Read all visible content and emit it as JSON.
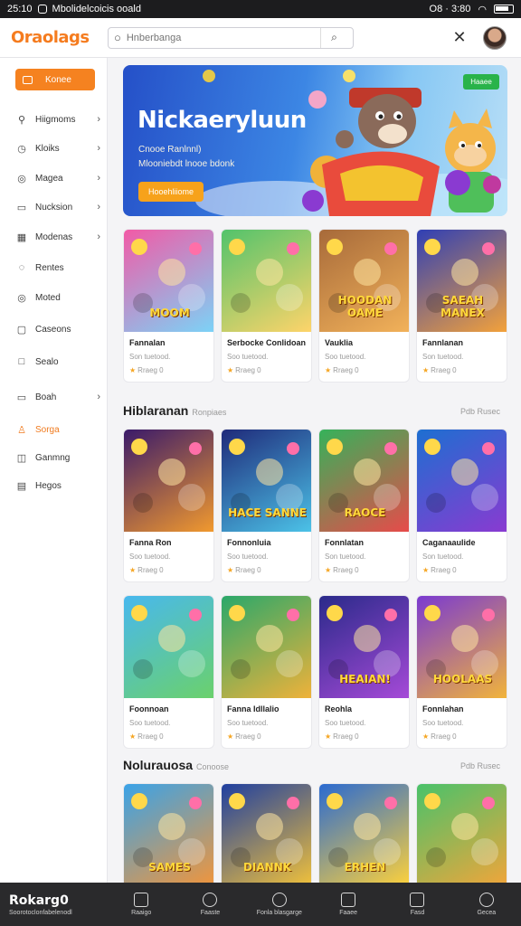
{
  "status_bar": {
    "time": "25:10",
    "notification": "Mbolidelcoicis ooald",
    "right_text": "O8 · 3:80"
  },
  "header": {
    "logo": "Oraolags",
    "search_placeholder": "Hnberbanga"
  },
  "sidebar": {
    "home_label": "Konee",
    "items": [
      {
        "label": "Hiigmoms",
        "icon": "controller-icon",
        "chevron": true
      },
      {
        "label": "Kloiks",
        "icon": "clock-icon",
        "chevron": true
      },
      {
        "label": "Magea",
        "icon": "circle-icon",
        "chevron": true
      },
      {
        "label": "Nucksion",
        "icon": "card-icon",
        "chevron": true
      },
      {
        "label": "Modenas",
        "icon": "grid-icon",
        "chevron": true
      },
      {
        "label": "Rentes",
        "icon": "shield-icon",
        "chevron": false
      },
      {
        "label": "Moted",
        "icon": "target-icon",
        "chevron": false
      },
      {
        "label": "Caseons",
        "icon": "doc-icon",
        "chevron": false
      },
      {
        "label": "Sealo",
        "icon": "box-icon",
        "chevron": false
      },
      {
        "label": "Boah",
        "icon": "folder-icon",
        "chevron": true
      },
      {
        "label": "Sorga",
        "icon": "user-icon",
        "chevron": false,
        "active": true
      },
      {
        "label": "Ganmng",
        "icon": "bag-icon",
        "chevron": false
      },
      {
        "label": "Hegos",
        "icon": "list-icon",
        "chevron": false
      }
    ]
  },
  "hero": {
    "title": "Nickaeryluun",
    "subtitle1": "Cnooe Ranlnnl)",
    "subtitle2": "Mlooniebdt lnooe bdonk",
    "button": "Hooehliiome",
    "badge": "Haaee"
  },
  "sections": [
    {
      "title": "",
      "tag": "",
      "more": "",
      "cards": [
        {
          "title": "Fannalan",
          "desc": "Son tuetood.",
          "rating": "Rraeg 0",
          "art": "MOOM",
          "c1": "#f25aa6",
          "c2": "#7bd3f7"
        },
        {
          "title": "Serbocke Conlidoan",
          "desc": "Soo tuetood.",
          "rating": "Rraeg 0",
          "art": "",
          "c1": "#52c36b",
          "c2": "#ffd46a"
        },
        {
          "title": "Vauklia",
          "desc": "Soo tuetood.",
          "rating": "Rraeg 0",
          "art": "HOODAN OAME",
          "c1": "#a76a3a",
          "c2": "#f2b25a"
        },
        {
          "title": "Fannlanan",
          "desc": "Son tuetood.",
          "rating": "Rraeg 0",
          "art": "SAEAH MANEX",
          "c1": "#2f3fb5",
          "c2": "#f4a23a"
        }
      ]
    },
    {
      "title": "Hiblaranan",
      "tag": "Ronpiaes",
      "more": "Pdb Rusec",
      "cards": [
        {
          "title": "Fanna Ron",
          "desc": "Soo tuetood.",
          "rating": "Rraeg 0",
          "art": "",
          "c1": "#3a1a6a",
          "c2": "#f29a2e"
        },
        {
          "title": "Fonnonluia",
          "desc": "Soo tuetood.",
          "rating": "Rraeg 0",
          "art": "HACE SANNE",
          "c1": "#1f2a7a",
          "c2": "#4cc3e8"
        },
        {
          "title": "Fonnlatan",
          "desc": "Son tuetood.",
          "rating": "Rraeg 0",
          "art": "RAOCE",
          "c1": "#35b25a",
          "c2": "#e84a4a"
        },
        {
          "title": "Caganaaulide",
          "desc": "Son tuetood.",
          "rating": "Rraeg 0",
          "art": "",
          "c1": "#1d6fd1",
          "c2": "#8a3ad1"
        }
      ]
    },
    {
      "title": "",
      "tag": "",
      "more": "",
      "cards": [
        {
          "title": "Foonnoan",
          "desc": "Soo tuetood.",
          "rating": "Rraeg 0",
          "art": "",
          "c1": "#48b8ee",
          "c2": "#6bd16b"
        },
        {
          "title": "Fanna Idllalio",
          "desc": "Soo tuetood.",
          "rating": "Rraeg 0",
          "art": "",
          "c1": "#2aa86a",
          "c2": "#f0b23a"
        },
        {
          "title": "Reohla",
          "desc": "Soo tuetood.",
          "rating": "Rraeg 0",
          "art": "HEAIAN!",
          "c1": "#2a2a8a",
          "c2": "#a64ad8"
        },
        {
          "title": "Fonnlahan",
          "desc": "Soo tuetood.",
          "rating": "Rraeg 0",
          "art": "HOOLAAS",
          "c1": "#7a3ad1",
          "c2": "#f2b43a"
        }
      ]
    },
    {
      "title": "Nolurauosa",
      "tag": "Conoose",
      "more": "Pdb Rusec",
      "cards": [
        {
          "title": "",
          "desc": "",
          "rating": "",
          "art": "SAMES",
          "c1": "#3aa3e8",
          "c2": "#f2953a"
        },
        {
          "title": "",
          "desc": "",
          "rating": "",
          "art": "DIANNK",
          "c1": "#1f3fa0",
          "c2": "#f2c23a"
        },
        {
          "title": "",
          "desc": "",
          "rating": "",
          "art": "ERHEN",
          "c1": "#2a6ad1",
          "c2": "#ffd23a"
        },
        {
          "title": "",
          "desc": "",
          "rating": "",
          "art": "",
          "c1": "#49c26a",
          "c2": "#f2a53a"
        }
      ]
    }
  ],
  "bottom_nav": {
    "brand": "Rokarg0",
    "brand_sub": "Soorotoclonfabelenodl",
    "items": [
      {
        "label": "Raaigo",
        "icon": "home-icon"
      },
      {
        "label": "Faaste",
        "icon": "rocket-icon"
      },
      {
        "label": "Fonla blasgarge",
        "icon": "chat-icon"
      },
      {
        "label": "Faaee",
        "icon": "image-icon"
      },
      {
        "label": "Fasd",
        "icon": "square-icon"
      },
      {
        "label": "Gecea",
        "icon": "person-icon"
      }
    ]
  }
}
